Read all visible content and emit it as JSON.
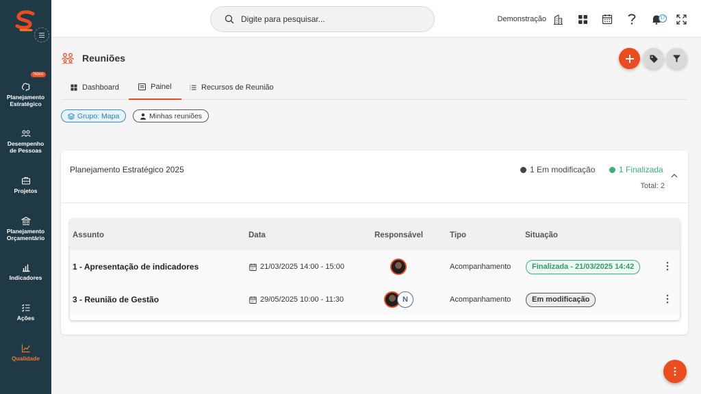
{
  "app": {
    "brand_color": "#ea4b1f",
    "sidebar_color": "#1f3a46"
  },
  "sidebar": {
    "badge_novo": "Novo",
    "items": [
      {
        "label_line1": "Planejamento",
        "label_line2": "Estratégico",
        "icon": "brain-icon"
      },
      {
        "label_line1": "Desempenho",
        "label_line2": "de Pessoas",
        "icon": "people-icon"
      },
      {
        "label_line1": "Projetos",
        "label_line2": "",
        "icon": "briefcase-icon"
      },
      {
        "label_line1": "Planejamento",
        "label_line2": "Orçamentário",
        "icon": "bank-icon"
      },
      {
        "label_line1": "Indicadores",
        "label_line2": "",
        "icon": "bar-chart-icon"
      },
      {
        "label_line1": "Ações",
        "label_line2": "",
        "icon": "checklist-icon"
      },
      {
        "label_line1": "Qualidade",
        "label_line2": "",
        "icon": "trend-icon",
        "active": true
      }
    ]
  },
  "topbar": {
    "search_placeholder": "Digite para pesquisar...",
    "company_label": "Demonstração",
    "notification_count": "17"
  },
  "page": {
    "title": "Reuniões",
    "tabs": [
      {
        "label": "Dashboard",
        "icon": "grid-icon"
      },
      {
        "label": "Painel",
        "icon": "panel-icon",
        "active": true
      },
      {
        "label": "Recursos de Reunião",
        "icon": "list-icon"
      }
    ],
    "chips": [
      {
        "label": "Grupo: Mapa",
        "icon": "layers-icon"
      },
      {
        "label": "Minhas reuniões",
        "icon": "person-icon"
      }
    ]
  },
  "card": {
    "title": "Planejamento Estratégico 2025",
    "status_modification": "1 Em modificação",
    "status_finalized": "1 Finalizada",
    "total": "Total: 2",
    "status_colors": {
      "modification": "#444444",
      "finalized": "#3bb07a"
    },
    "table": {
      "headers": [
        "Assunto",
        "Data",
        "Responsável",
        "Tipo",
        "Situação"
      ],
      "rows": [
        {
          "subject": "1 - Apresentação de indicadores",
          "date": "21/03/2025 14:00 - 15:00",
          "type": "Acompanhamento",
          "status": "Finalizada - 21/03/2025 14:42"
        },
        {
          "subject": "3 - Reunião de Gestão",
          "date": "29/05/2025 10:00 - 11:30",
          "type": "Acompanhamento",
          "status": "Em modificação",
          "avatar_letter": "N"
        }
      ]
    }
  }
}
